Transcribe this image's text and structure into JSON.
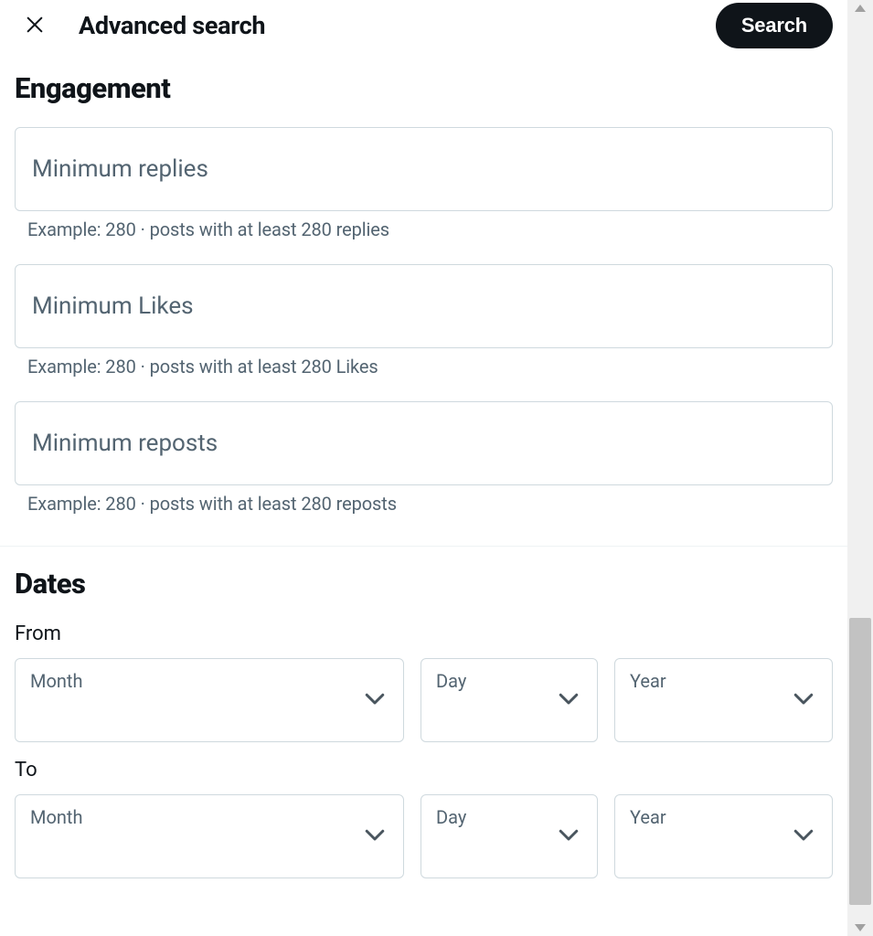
{
  "header": {
    "title": "Advanced search",
    "search_button": "Search"
  },
  "engagement": {
    "title": "Engagement",
    "fields": [
      {
        "placeholder": "Minimum replies",
        "hint": "Example: 280 · posts with at least 280 replies"
      },
      {
        "placeholder": "Minimum Likes",
        "hint": "Example: 280 · posts with at least 280 Likes"
      },
      {
        "placeholder": "Minimum reposts",
        "hint": "Example: 280 · posts with at least 280 reposts"
      }
    ]
  },
  "dates": {
    "title": "Dates",
    "from_label": "From",
    "to_label": "To",
    "select_labels": {
      "month": "Month",
      "day": "Day",
      "year": "Year"
    }
  }
}
